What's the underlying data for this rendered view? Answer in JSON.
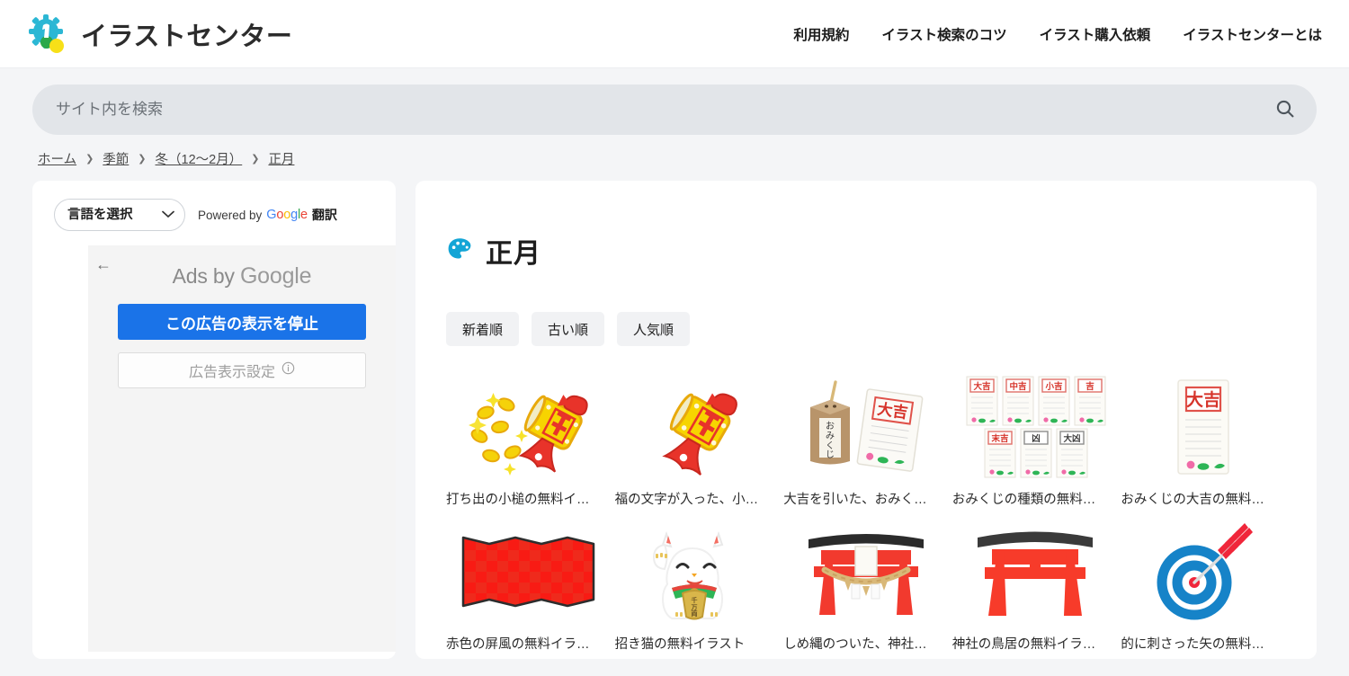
{
  "header": {
    "brand_name": "イラストセンター",
    "logo_icon": "gear-splat-logo",
    "nav": [
      {
        "label": "利用規約"
      },
      {
        "label": "イラスト検索のコツ"
      },
      {
        "label": "イラスト購入依頼"
      },
      {
        "label": "イラストセンターとは"
      }
    ]
  },
  "search": {
    "placeholder": "サイト内を検索",
    "value": "",
    "icon": "search-icon"
  },
  "breadcrumb": {
    "separator": "❯",
    "items": [
      {
        "label": "ホーム"
      },
      {
        "label": "季節"
      },
      {
        "label": "冬（12〜2月）"
      },
      {
        "label": "正月"
      }
    ]
  },
  "sidebar": {
    "language_select": {
      "selected": "言語を選択",
      "options": [
        "言語を選択"
      ],
      "caret_icon": "chevron-down-icon"
    },
    "powered_by": {
      "prefix": "Powered by",
      "google": [
        "G",
        "o",
        "o",
        "g",
        "l",
        "e"
      ],
      "suffix": "翻訳"
    },
    "ad": {
      "back_icon": "back-arrow-icon",
      "title_prefix": "Ads by ",
      "title_google": "Google",
      "stop_button": "この広告の表示を停止",
      "settings_button": "広告表示設定",
      "settings_info_icon": "info-icon"
    }
  },
  "main": {
    "title_icon": "palette-icon",
    "title": "正月",
    "accent_color": "#1aa3d8",
    "sort_buttons": [
      {
        "label": "新着順"
      },
      {
        "label": "古い順"
      },
      {
        "label": "人気順"
      }
    ],
    "items": [
      {
        "caption": "打ち出の小槌の無料イ…",
        "icon": "golden-mallet-with-coins"
      },
      {
        "caption": "福の文字が入った、小…",
        "icon": "golden-mallet"
      },
      {
        "caption": "大吉を引いた、おみく…",
        "icon": "omikuji-box-and-slip"
      },
      {
        "caption": "おみくじの種類の無料…",
        "icon": "omikuji-types",
        "slips": [
          "大吉",
          "中吉",
          "小吉",
          "吉",
          "末吉",
          "凶",
          "大凶"
        ]
      },
      {
        "caption": "おみくじの大吉の無料…",
        "icon": "omikuji-daikichi-slip",
        "slip_label": "大吉"
      },
      {
        "caption": "赤色の屏風の無料イラ…",
        "icon": "red-folding-screen"
      },
      {
        "caption": "招き猫の無料イラスト",
        "icon": "maneki-neko"
      },
      {
        "caption": "しめ縄のついた、神社…",
        "icon": "torii-with-shimenawa"
      },
      {
        "caption": "神社の鳥居の無料イラ…",
        "icon": "torii-gate"
      },
      {
        "caption": "的に刺さった矢の無料…",
        "icon": "target-with-arrow"
      }
    ]
  }
}
